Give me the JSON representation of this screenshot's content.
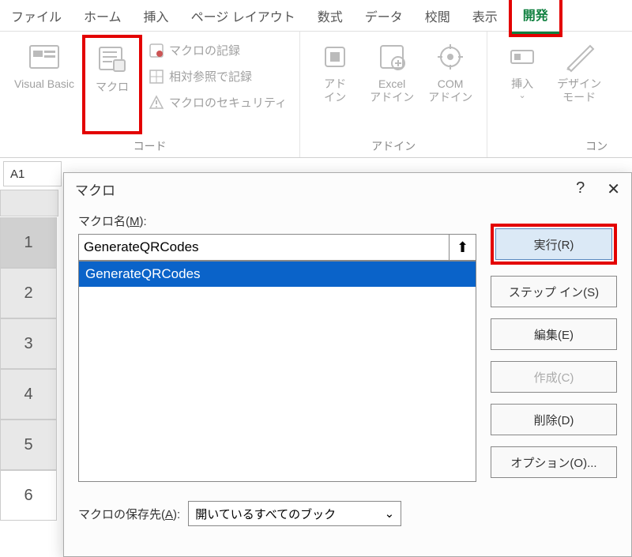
{
  "ribbon": {
    "tabs": [
      "ファイル",
      "ホーム",
      "挿入",
      "ページ レイアウト",
      "数式",
      "データ",
      "校閲",
      "表示",
      "開発"
    ],
    "active_tab": "開発",
    "groups": {
      "code": {
        "vb": "Visual Basic",
        "macros": "マクロ",
        "record": "マクロの記録",
        "relative": "相対参照で記録",
        "security": "マクロのセキュリティ",
        "label": "コード"
      },
      "addins": {
        "addin": "アド\nイン",
        "excel_addin": "Excel\nアドイン",
        "com_addin": "COM\nアドイン",
        "label": "アドイン"
      },
      "controls": {
        "insert": "挿入",
        "design": "デザイン\nモード",
        "label": "コン"
      }
    }
  },
  "namebox": "A1",
  "rows": [
    "1",
    "2",
    "3",
    "4",
    "5",
    "6"
  ],
  "dialog": {
    "title": "マクロ",
    "help": "?",
    "close": "✕",
    "name_label_pre": "マクロ名(",
    "name_label_u": "M",
    "name_label_post": "):",
    "name_value": "GenerateQRCodes",
    "list": [
      "GenerateQRCodes"
    ],
    "save_label_pre": "マクロの保存先(",
    "save_label_u": "A",
    "save_label_post": "):",
    "save_value": "開いているすべてのブック",
    "buttons": {
      "run": "実行(R)",
      "step": "ステップ イン(S)",
      "edit": "編集(E)",
      "create": "作成(C)",
      "delete": "削除(D)",
      "options": "オプション(O)..."
    }
  }
}
